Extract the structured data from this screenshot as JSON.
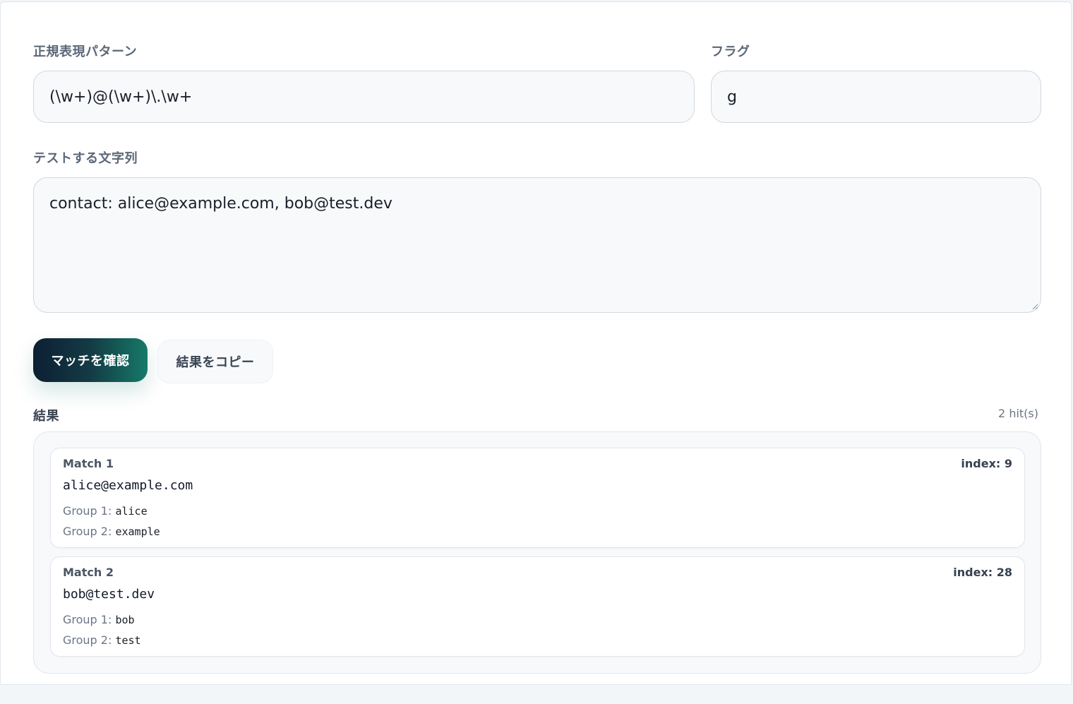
{
  "pattern": {
    "label": "正規表現パターン",
    "value": "(\\w+)@(\\w+)\\.\\w+"
  },
  "flags": {
    "label": "フラグ",
    "value": "g"
  },
  "test_string": {
    "label": "テストする文字列",
    "value": "contact: alice@example.com, bob@test.dev"
  },
  "buttons": {
    "check_label": "マッチを確認",
    "copy_label": "結果をコピー"
  },
  "results": {
    "label": "結果",
    "hits": "2 hit(s)",
    "matches": [
      {
        "title": "Match 1",
        "index": "index: 9",
        "value": "alice@example.com",
        "groups": [
          {
            "label": "Group 1:",
            "value": "alice"
          },
          {
            "label": "Group 2:",
            "value": "example"
          }
        ]
      },
      {
        "title": "Match 2",
        "index": "index: 28",
        "value": "bob@test.dev",
        "groups": [
          {
            "label": "Group 1:",
            "value": "bob"
          },
          {
            "label": "Group 2:",
            "value": "test"
          }
        ]
      }
    ]
  }
}
